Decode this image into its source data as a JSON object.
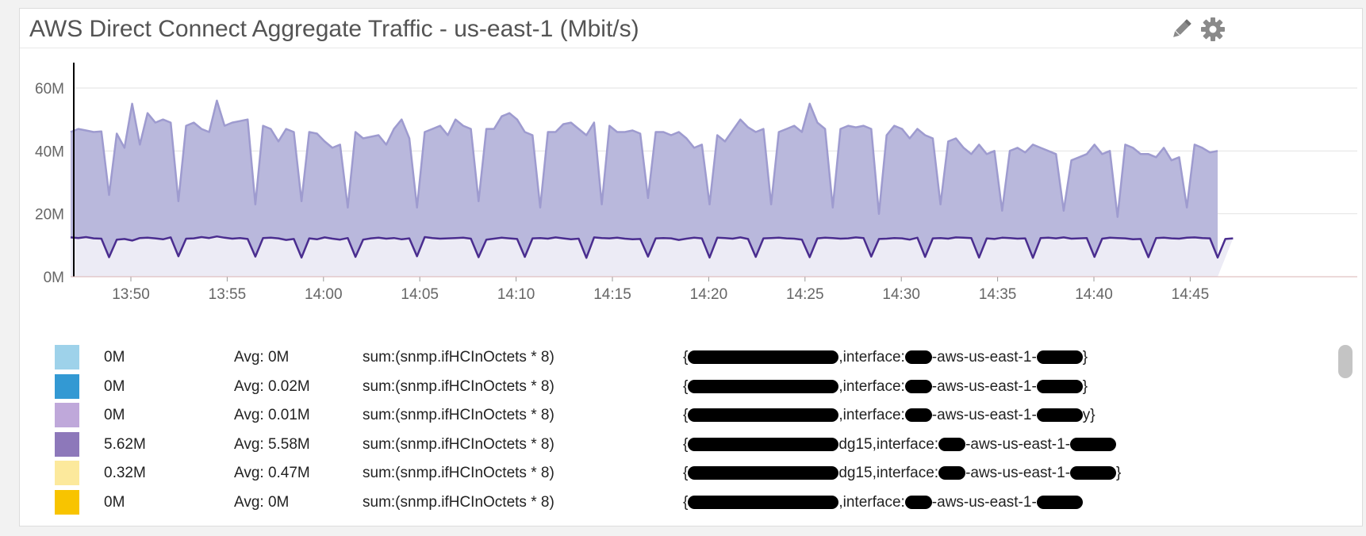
{
  "widget": {
    "title": "AWS Direct Connect Aggregate Traffic - us-east-1 (Mbit/s)",
    "edit_icon": "pencil-icon",
    "settings_icon": "gear-icon"
  },
  "colors": {
    "upper_fill": "#b9b8dc",
    "upper_line": "#9e9bcf",
    "lower_fill": "#ecebf5",
    "lower_line": "#4a2d8f",
    "gridline": "#e2e2e2",
    "axis": "#000000"
  },
  "chart_data": {
    "type": "area",
    "stacked": true,
    "y_ticks": [
      "0M",
      "20M",
      "40M",
      "60M"
    ],
    "ylim": [
      0,
      70
    ],
    "x_ticks": [
      "13:50",
      "13:55",
      "14:00",
      "14:05",
      "14:10",
      "14:15",
      "14:20",
      "14:25",
      "14:30",
      "14:35",
      "14:40",
      "14:45"
    ],
    "grid": true,
    "series": [
      {
        "values": [
          12.5,
          12.3,
          12.6,
          12.2,
          12.1,
          6.2,
          11.8,
          12.0,
          11.5,
          12.3,
          12.4,
          12.2,
          11.9,
          12.5,
          6.5,
          12.1,
          12.2,
          12.6,
          12.3,
          12.8,
          12.4,
          12.1,
          12.3,
          12.0,
          6.4,
          12.3,
          12.4,
          12.2,
          11.7,
          12.0,
          6.1,
          12.2,
          11.9,
          12.5,
          12.1,
          11.8,
          12.3,
          6.3,
          11.8,
          12.2,
          12.4,
          12.1,
          12.3,
          11.9,
          12.2,
          6.5,
          12.6,
          12.3,
          12.1,
          12.2,
          12.3,
          12.4,
          12.1,
          6.2,
          11.8,
          12.1,
          12.4,
          12.2,
          12.0,
          6.3,
          12.2,
          12.3,
          12.1,
          12.5,
          12.2,
          11.9,
          12.1,
          6.0,
          12.5,
          12.3,
          12.2,
          12.4,
          12.1,
          11.9,
          12.0,
          6.4,
          12.2,
          12.3,
          12.2,
          11.7,
          12.1,
          12.4,
          12.2,
          6.1,
          12.4,
          12.3,
          12.1,
          12.5,
          12.0,
          6.3,
          12.2,
          12.3,
          12.4,
          12.2,
          12.1,
          11.8,
          6.2,
          12.2,
          12.4,
          12.3,
          12.1,
          12.2,
          12.5,
          12.3,
          6.4,
          12.0,
          12.1,
          12.3,
          12.2,
          11.8,
          12.4,
          6.3,
          12.2,
          12.3,
          12.1,
          12.5,
          12.4,
          12.3,
          6.1,
          12.2,
          12.0,
          12.4,
          12.3,
          12.1,
          12.2,
          6.0,
          12.3,
          12.4,
          12.2,
          12.5,
          12.1,
          12.2,
          12.3,
          6.3,
          12.1,
          12.4,
          12.3,
          12.2,
          11.9,
          12.0,
          6.2,
          12.3,
          12.4,
          12.2,
          12.1,
          12.4,
          12.5,
          12.3,
          12.2,
          6.1,
          12.0,
          12.2
        ],
        "name": ""
      },
      {
        "values": [
          46,
          47,
          46.5,
          46,
          46.2,
          26,
          45.5,
          41,
          55,
          42,
          52,
          49,
          50,
          49,
          24,
          48,
          49,
          47,
          46,
          56,
          48,
          49,
          49.5,
          50,
          23,
          48,
          47,
          43,
          47,
          46,
          24,
          46,
          45.5,
          43,
          41,
          42,
          22,
          46,
          44,
          44.5,
          45,
          42,
          47,
          50,
          44,
          22,
          46,
          47,
          48,
          45,
          50,
          48,
          47,
          24,
          47,
          47,
          51,
          52,
          50,
          46,
          45,
          22,
          46,
          46,
          48.5,
          49,
          47,
          45,
          49,
          23,
          48,
          46,
          46,
          46.5,
          45.5,
          25,
          46,
          46,
          45,
          46,
          44,
          41,
          42,
          23,
          45,
          43,
          46.5,
          50,
          47.5,
          46,
          47,
          23,
          46,
          47,
          48,
          46,
          55,
          49,
          47,
          22,
          47,
          48,
          47.5,
          48,
          47,
          20,
          45,
          48,
          47,
          44,
          47,
          45,
          44,
          23,
          43,
          44,
          41,
          39,
          42,
          39,
          40,
          21,
          40,
          41,
          39.5,
          42,
          41,
          40,
          39,
          21,
          37,
          38,
          39,
          42,
          39,
          40,
          19,
          42,
          41,
          39,
          39,
          38,
          41,
          37,
          38,
          22,
          42,
          41,
          39.5,
          40
        ],
        "name": ""
      }
    ]
  },
  "legend": {
    "rows": [
      {
        "color": "#9ed2ea",
        "current": "0M",
        "avg": "Avg: 0M",
        "query": "sum:(snmp.ifHCInOctets * 8)",
        "tags_visible": "{",
        "tags_tail": ",interface:",
        "tags_tail2": "-aws-us-east-1-",
        "tags_end": "}"
      },
      {
        "color": "#3399d3",
        "current": "0M",
        "avg": "Avg: 0.02M",
        "query": "sum:(snmp.ifHCInOctets * 8)",
        "tags_visible": "{",
        "tags_tail": ",interface:",
        "tags_tail2": "-aws-us-east-1-",
        "tags_end": "}"
      },
      {
        "color": "#bfa8da",
        "current": "0M",
        "avg": "Avg: 0.01M",
        "query": "sum:(snmp.ifHCInOctets * 8)",
        "tags_visible": "{",
        "tags_tail": ",interface:",
        "tags_tail2": "-aws-us-east-1-",
        "tags_end": "y}"
      },
      {
        "color": "#8d78ba",
        "current": "5.62M",
        "avg": "Avg: 5.58M",
        "query": "sum:(snmp.ifHCInOctets * 8)",
        "tags_visible": "{",
        "tags_tail": "dg15,interface:",
        "tags_tail2": "-aws-us-east-1-",
        "tags_end": ""
      },
      {
        "color": "#fce99c",
        "current": "0.32M",
        "avg": "Avg: 0.47M",
        "query": "sum:(snmp.ifHCInOctets * 8)",
        "tags_visible": "{",
        "tags_tail": "dg15,interface:",
        "tags_tail2": "-aws-us-east-1-",
        "tags_end": "}"
      },
      {
        "color": "#f8c400",
        "current": "0M",
        "avg": "Avg: 0M",
        "query": "sum:(snmp.ifHCInOctets * 8)",
        "tags_visible": "{",
        "tags_tail": ",interface:",
        "tags_tail2": "-aws-us-east-1-",
        "tags_end": ""
      }
    ]
  }
}
